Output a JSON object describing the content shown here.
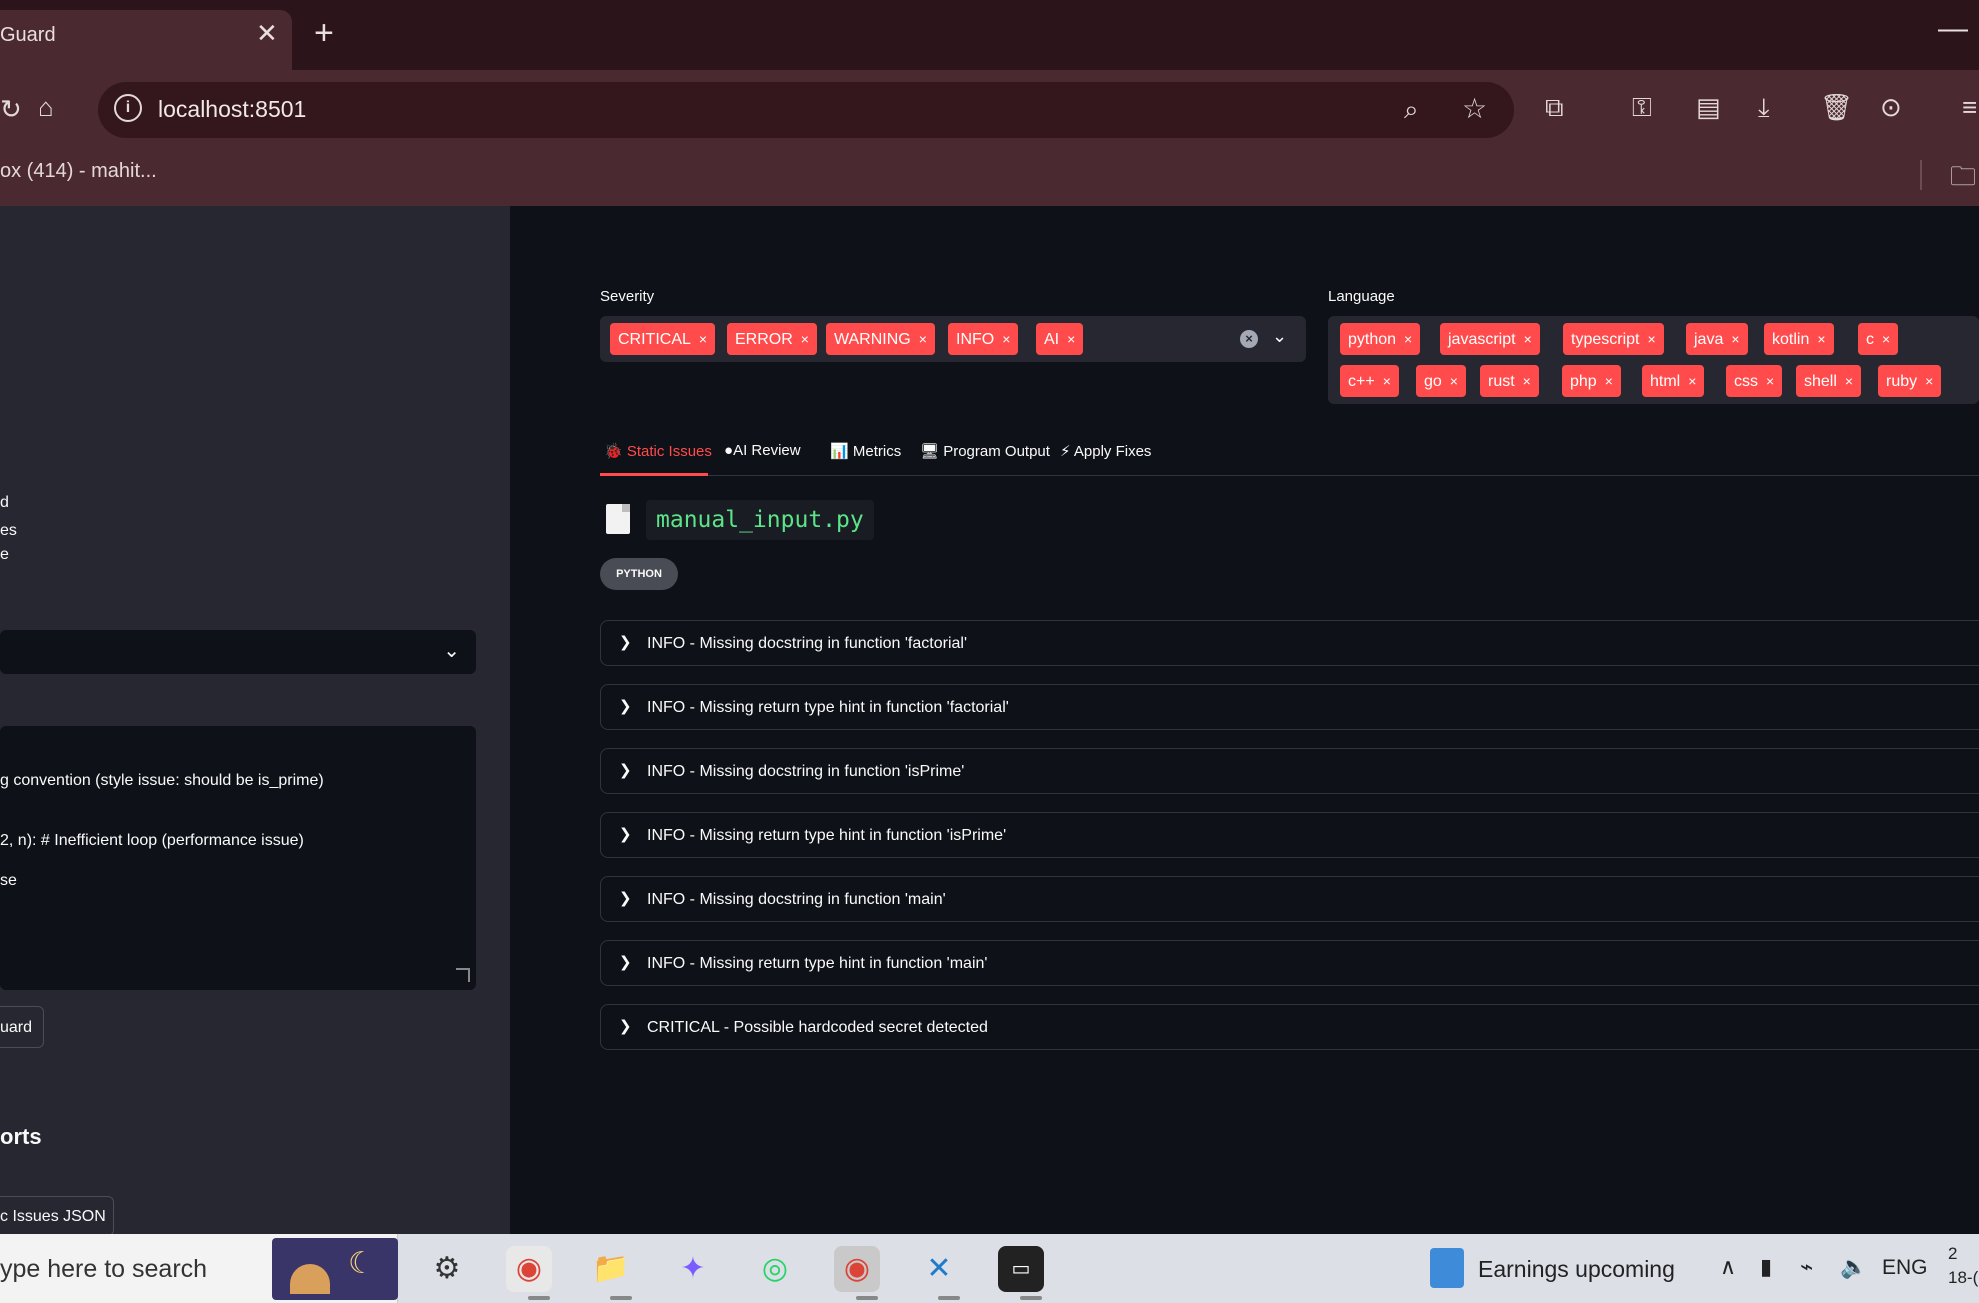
{
  "browser": {
    "tab_title": "Guard",
    "tab_close": "✕",
    "new_tab": "+",
    "minimize": "—",
    "url": "localhost:8501",
    "bookmark": "ox (414) - mahit..."
  },
  "sidebar": {
    "frag1": "d",
    "frag2": "es",
    "frag3": "e",
    "code_lines": [
      "g convention (style issue: should be is_prime)",
      "2, n):  # Inefficient loop (performance issue)",
      "se"
    ],
    "run_button": "uard",
    "reports_heading": "orts",
    "download_json": "c Issues JSON"
  },
  "filters": {
    "severity_label": "Severity",
    "severity_chips": [
      "CRITICAL",
      "ERROR",
      "WARNING",
      "INFO",
      "AI"
    ],
    "language_label": "Language",
    "language_chips_row1": [
      "python",
      "javascript",
      "typescript",
      "java",
      "kotlin",
      "c"
    ],
    "language_chips_row2": [
      "c++",
      "go",
      "rust",
      "php",
      "html",
      "css",
      "shell",
      "ruby"
    ],
    "chip_remove": "×",
    "clear": "×"
  },
  "tabs": [
    {
      "label": "Static Issues",
      "icon": "🐞"
    },
    {
      "label": "AI Review",
      "icon": "●"
    },
    {
      "label": "Metrics",
      "icon": "📊"
    },
    {
      "label": "Program Output",
      "icon": "🖥"
    },
    {
      "label": "Apply Fixes",
      "icon": "⚡"
    }
  ],
  "file": {
    "name": "manual_input.py",
    "language_badge": "PYTHON"
  },
  "issues": [
    "INFO - Missing docstring in function 'factorial'",
    "INFO - Missing return type hint in function 'factorial'",
    "INFO - Missing docstring in function 'isPrime'",
    "INFO - Missing return type hint in function 'isPrime'",
    "INFO - Missing docstring in function 'main'",
    "INFO - Missing return type hint in function 'main'",
    "CRITICAL - Possible hardcoded secret detected"
  ],
  "taskbar": {
    "search_placeholder": "ype here to search",
    "news": "Earnings upcoming",
    "language": "ENG",
    "time_partial": "2",
    "date_partial": "18-("
  },
  "colors": {
    "accent": "#ff4b4b",
    "background": "#0e1117",
    "sidebar": "#262730",
    "browser_chrome": "#4a2a30",
    "filename": "#5ce488"
  }
}
